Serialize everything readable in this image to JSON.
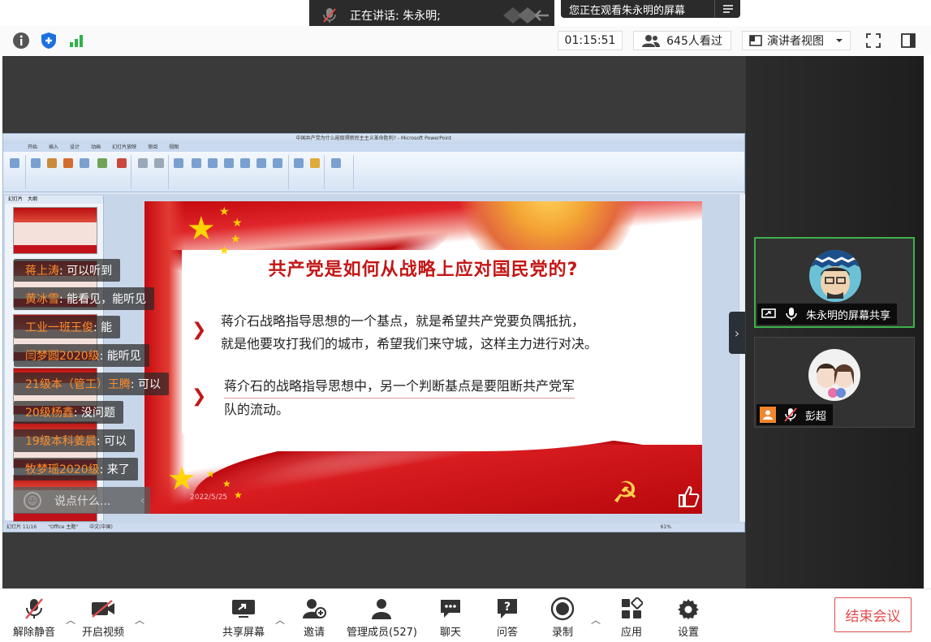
{
  "notifications": {
    "speaking_label": "正在讲话: 朱永明;",
    "viewing_label": "您正在观看朱永明的屏幕"
  },
  "topbar": {
    "timer": "01:15:51",
    "viewers": "645人看过",
    "view_mode": "演讲者视图"
  },
  "ppt": {
    "title": "中国共产党为什么能取得新民主主义革命胜利? - Microsoft PowerPoint",
    "tabs": [
      "开始",
      "插入",
      "设计",
      "动画",
      "幻灯片放映",
      "审阅",
      "视图"
    ],
    "thumb_tabs": [
      "幻灯片",
      "大纲"
    ],
    "status": [
      "幻灯片 11/16",
      "\"Office 主题\"",
      "中文(中国)"
    ],
    "zoom": "61%"
  },
  "slide": {
    "title": "共产党是如何从战略上应对国民党的?",
    "bullet1_line1": "蒋介石战略指导思想的一个基点，就是希望共产党要负隅抵抗，",
    "bullet1_line2": "就是他要攻打我们的城市，希望我们来守城，这样主力进行对决。",
    "bullet2_line1": "蒋介石的战略指导思想中，另一个判断基点是要阻断共产党军",
    "bullet2_line2": "队的流动。",
    "date": "2022/5/25"
  },
  "chat": {
    "messages": [
      {
        "who": "蒋上涛",
        "msg": ": 可以听到"
      },
      {
        "who": "黄冰雪",
        "msg": ": 能看见，能听见"
      },
      {
        "who": "工业一班王俊",
        "msg": ": 能"
      },
      {
        "who": "闫梦圆2020级",
        "msg": ": 能听见"
      },
      {
        "who": "21级本（管工）王腾",
        "msg": ": 可以"
      },
      {
        "who": "20级杨鑫",
        "msg": ": 没问题"
      },
      {
        "who": "19级本科姜晨",
        "msg": ": 可以"
      },
      {
        "who": "牧梦瑶2020级",
        "msg": ": 来了"
      }
    ],
    "input_placeholder": "说点什么..."
  },
  "participants": [
    {
      "name": "朱永明的屏幕共享"
    },
    {
      "name": "彭超"
    }
  ],
  "bottombar": {
    "unmute": "解除静音",
    "start_video": "开启视频",
    "share_screen": "共享屏幕",
    "invite": "邀请",
    "manage": "管理成员(527)",
    "chat": "聊天",
    "qa": "问答",
    "record": "录制",
    "apps": "应用",
    "settings": "设置",
    "end_meeting": "结束会议"
  },
  "colors": {
    "accent_red": "#e34a4a",
    "active_green": "#3db24a",
    "chat_name": "#ff8c2a",
    "slide_red": "#c41616"
  }
}
